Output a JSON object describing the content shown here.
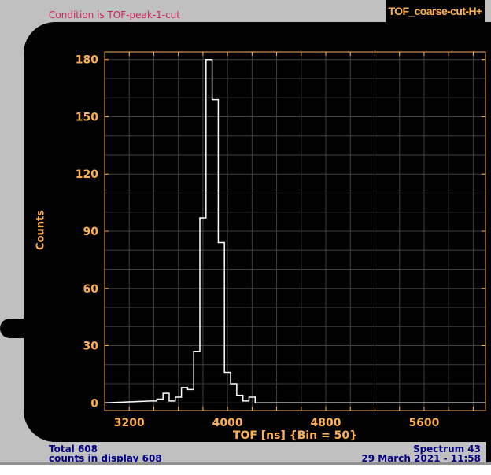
{
  "condition_text": "Condition is TOF-peak-1-cut",
  "spectrum_title": "TOF_coarse-cut-H+",
  "footer": {
    "total": "Total 608",
    "counts_in_display": "counts in display 608",
    "spectrum": "Spectrum 43",
    "datetime": "29 March 2021 - 11:58"
  },
  "colors": {
    "axis": "#ffb050",
    "grid": "#404040",
    "trace": "#ffffff",
    "condition": "#d0205a",
    "footer": "#000080"
  },
  "chart_data": {
    "type": "bar",
    "style": "step-histogram",
    "title": "TOF_coarse-cut-H+",
    "xlabel": "TOF [ns] {Bin = 50}",
    "ylabel": "Counts",
    "bin_width": 50,
    "bin_start": 3375,
    "values": [
      1,
      2,
      5,
      1,
      3,
      8,
      7,
      27,
      97,
      180,
      159,
      84,
      16,
      10,
      4,
      1,
      3
    ],
    "xlim": [
      3000,
      6100
    ],
    "ylim": [
      -4,
      184
    ],
    "xticks": [
      3200,
      4000,
      4800,
      5600
    ],
    "yticks": [
      0,
      30,
      60,
      90,
      120,
      150,
      180
    ],
    "grid": true
  }
}
